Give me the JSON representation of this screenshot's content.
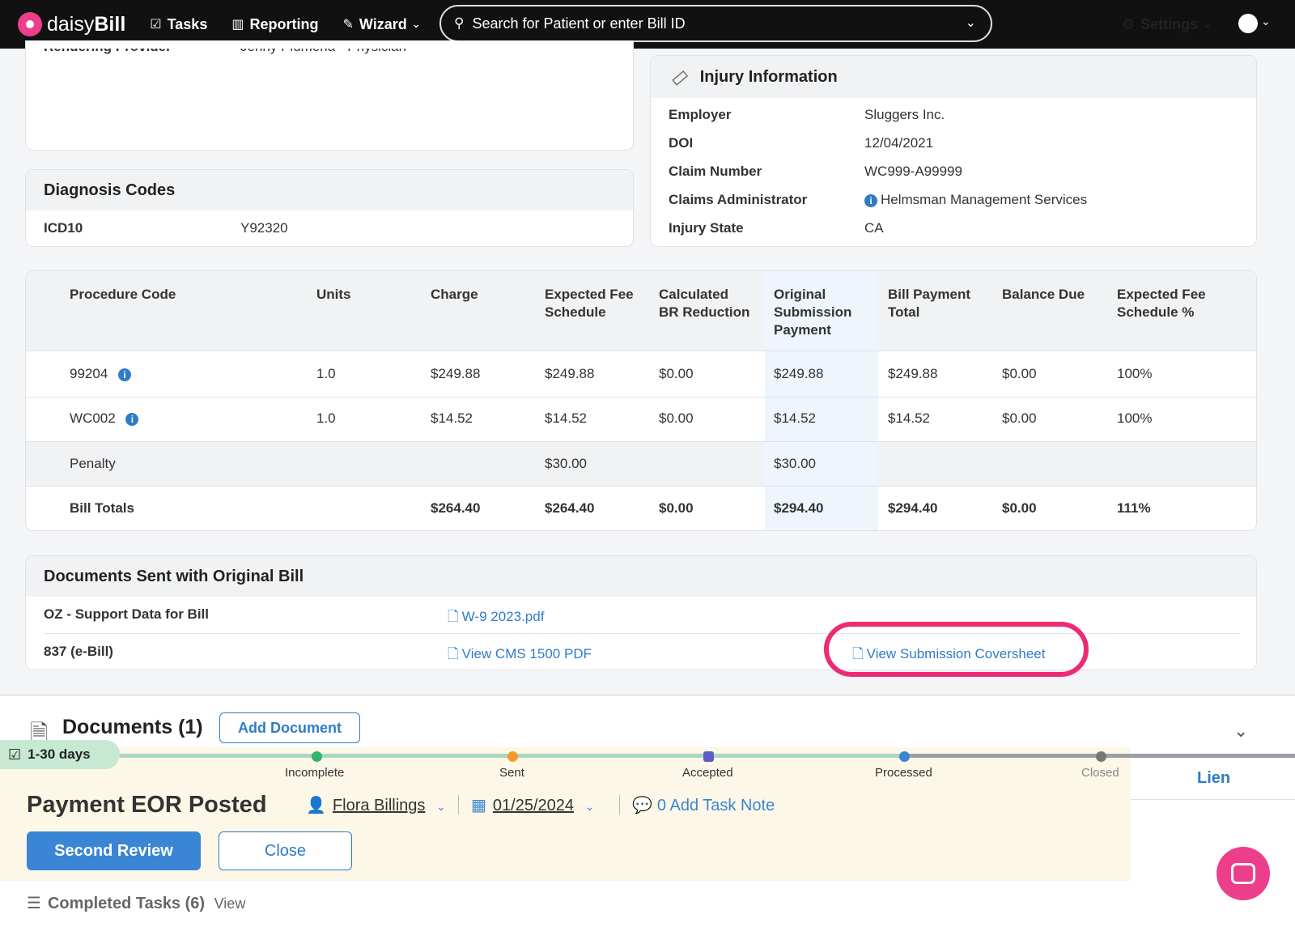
{
  "nav": {
    "brand_prefix": "daisy",
    "brand_suffix": "Bill",
    "tasks": "Tasks",
    "reporting": "Reporting",
    "wizard": "Wizard",
    "search_placeholder": "Search for Patient or enter Bill ID",
    "settings": "Settings"
  },
  "rendering": {
    "label": "Rendering Provider",
    "value": "Jenny Plumeria - Physician"
  },
  "diagnosis": {
    "title": "Diagnosis Codes",
    "code_type": "ICD10",
    "code": "Y92320"
  },
  "injury": {
    "title": "Injury Information",
    "rows": [
      {
        "label": "Employer",
        "value": "Sluggers Inc."
      },
      {
        "label": "DOI",
        "value": "12/04/2021"
      },
      {
        "label": "Claim Number",
        "value": "WC999-A99999"
      },
      {
        "label": "Claims Administrator",
        "value": "Helmsman Management Services"
      },
      {
        "label": "Injury State",
        "value": "CA"
      }
    ]
  },
  "procedures": {
    "headers": [
      [
        "Procedure Code"
      ],
      [
        "Units"
      ],
      [
        "Charge"
      ],
      [
        "Expected Fee",
        "Schedule"
      ],
      [
        "Calculated",
        "BR Reduction"
      ],
      [
        "Original",
        "Submission",
        "Payment"
      ],
      [
        "Bill Payment",
        "Total"
      ],
      [
        "Balance Due"
      ],
      [
        "Expected Fee",
        "Schedule %"
      ]
    ],
    "rows": [
      [
        "99204",
        "1.0",
        "$249.88",
        "$249.88",
        "$0.00",
        "$249.88",
        "$249.88",
        "$0.00",
        "100%"
      ],
      [
        "WC002",
        "1.0",
        "$14.52",
        "$14.52",
        "$0.00",
        "$14.52",
        "$14.52",
        "$0.00",
        "100%"
      ]
    ],
    "penalty": {
      "label": "Penalty",
      "expected": "$30.00",
      "original": "$30.00"
    },
    "totals": [
      "Bill Totals",
      "",
      "$264.40",
      "$264.40",
      "$0.00",
      "$294.40",
      "$294.40",
      "$0.00",
      "111%"
    ]
  },
  "docs_sent": {
    "title": "Documents Sent with Original Bill",
    "row1_label": "OZ - Support Data for Bill",
    "row1_link": "W-9 2023.pdf",
    "row2_label": "837 (e-Bill)",
    "row2_link": "View CMS 1500 PDF",
    "row2_link2": "View Submission Coversheet"
  },
  "documents": {
    "title": "Documents (1)",
    "add_button": "Add Document"
  },
  "task": {
    "age_chip": "1-30 days",
    "steps": [
      "Incomplete",
      "Sent",
      "Accepted",
      "Processed",
      "Closed"
    ],
    "side_tab": "Lien",
    "title": "Payment EOR Posted",
    "assignee": "Flora Billings",
    "date": "01/25/2024",
    "note": "0 Add Task Note",
    "primary_button": "Second Review",
    "close_button": "Close",
    "completed_label": "Completed Tasks (6)",
    "completed_view": "View"
  },
  "colors": {
    "accent": "#2f7cc8",
    "brand": "#ec3e8a",
    "highlight": "#ef2a74",
    "task_bg": "#fcf7e6"
  }
}
